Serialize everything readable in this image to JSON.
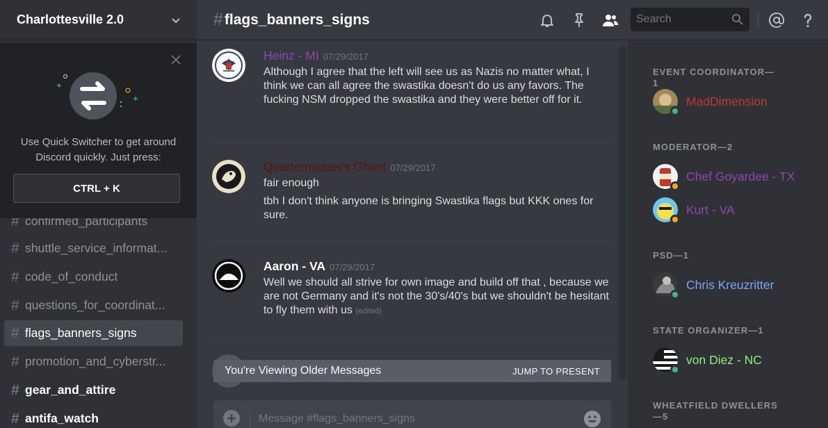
{
  "guild": {
    "name": "Charlottesville 2.0"
  },
  "quick_switcher": {
    "text": "Use Quick Switcher to get around Discord quickly. Just press:",
    "shortcut": "CTRL + K"
  },
  "channels": [
    {
      "name": "confirmed_participants",
      "state": "normal"
    },
    {
      "name": "shuttle_service_informat...",
      "state": "normal"
    },
    {
      "name": "code_of_conduct",
      "state": "normal"
    },
    {
      "name": "questions_for_coordinat...",
      "state": "normal"
    },
    {
      "name": "flags_banners_signs",
      "state": "active"
    },
    {
      "name": "promotion_and_cyberstr...",
      "state": "normal"
    },
    {
      "name": "gear_and_attire",
      "state": "unread"
    },
    {
      "name": "antifa_watch",
      "state": "unread"
    }
  ],
  "channel_hash": "#",
  "header": {
    "channel_name": "flags_banners_signs",
    "search_placeholder": "Search",
    "icons": [
      "bell-icon",
      "pin-icon",
      "members-icon",
      "search-icon",
      "mention-icon",
      "help-icon"
    ]
  },
  "messages": [
    {
      "author": "Heinz - MI",
      "author_color": "#8f47b3",
      "timestamp": "07/29/2017",
      "lines": [
        "Although I agree that the left will see us as Nazis no matter what, I think we can all agree the swastika doesn't do us any favors. The fucking NSM dropped the swastika and they were better off for it."
      ]
    },
    {
      "author": "Quartermaster's Ghost",
      "author_color": "#5b1313",
      "timestamp": "07/29/2017",
      "lines": [
        "fair enough",
        "tbh I don't think anyone is bringing Swastika flags but KKK ones for sure."
      ]
    },
    {
      "author": "Aaron - VA",
      "author_color": "#ffffff",
      "timestamp": "07/29/2017",
      "lines": [
        "Well we should all strive for own image and build off that , because we are not Germany and it's not the 30's/40's but we shouldn't be hesitant to fly them with us"
      ],
      "edited": "(edited)"
    }
  ],
  "older_messages_bar": {
    "text": "You're Viewing Older Messages",
    "jump_label": "JUMP TO PRESENT"
  },
  "composer": {
    "placeholder": "Message #flags_banners_signs"
  },
  "member_roles": [
    {
      "title": "EVENT COORDINATOR—1",
      "members": [
        {
          "name": "MadDimension",
          "color": "#c0392b",
          "status": "online"
        }
      ]
    },
    {
      "title": "MODERATOR—2",
      "members": [
        {
          "name": "Chef Goyardee - TX",
          "color": "#8f47b3",
          "status": "idle"
        },
        {
          "name": "Kurt - VA",
          "color": "#8f47b3",
          "status": "idle"
        }
      ]
    },
    {
      "title": "PSD—1",
      "members": [
        {
          "name": "Chris Kreuzritter",
          "color": "#7aa7f2",
          "status": "online"
        }
      ]
    },
    {
      "title": "STATE ORGANIZER—1",
      "members": [
        {
          "name": "von Diez - NC",
          "color": "#8ef07a",
          "status": "online"
        }
      ]
    },
    {
      "title": "WHEATFIELD DWELLERS—5",
      "members": []
    }
  ],
  "colors": {
    "online": "#43b581",
    "idle": "#faa61a",
    "accent": "#7289da"
  }
}
